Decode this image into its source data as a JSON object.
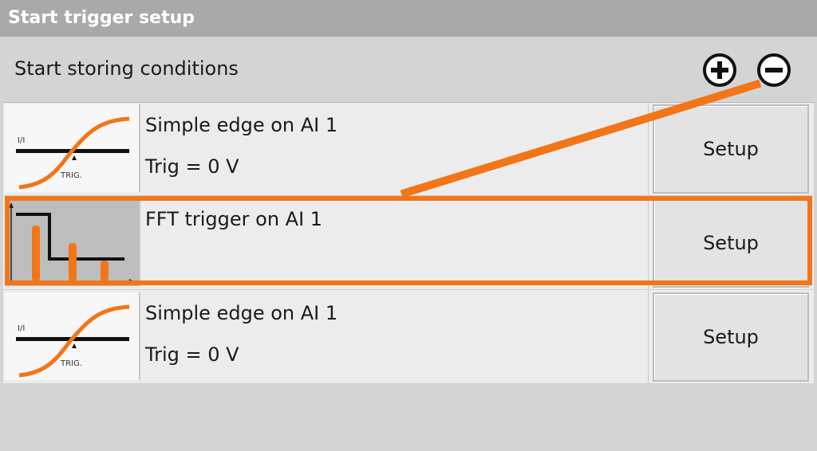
{
  "window": {
    "title": "Start trigger setup"
  },
  "header": {
    "label": "Start storing conditions",
    "add_icon": "plus-circle-icon",
    "remove_icon": "minus-circle-icon"
  },
  "rows": [
    {
      "icon": "edge-trigger-icon",
      "icon_label": "TRIG.",
      "title": "Simple edge on AI 1",
      "detail": "Trig = 0 V",
      "button": "Setup"
    },
    {
      "icon": "fft-trigger-icon",
      "title": "FFT trigger on AI 1",
      "detail": "",
      "button": "Setup",
      "selected": true
    },
    {
      "icon": "edge-trigger-icon",
      "icon_label": "TRIG.",
      "title": "Simple edge on AI 1",
      "detail": "Trig = 0 V",
      "button": "Setup"
    }
  ],
  "colors": {
    "accent": "#f27518",
    "titlebar": "#a9a9a9",
    "list_bg": "#ececec",
    "button_bg": "#e3e3e3"
  }
}
